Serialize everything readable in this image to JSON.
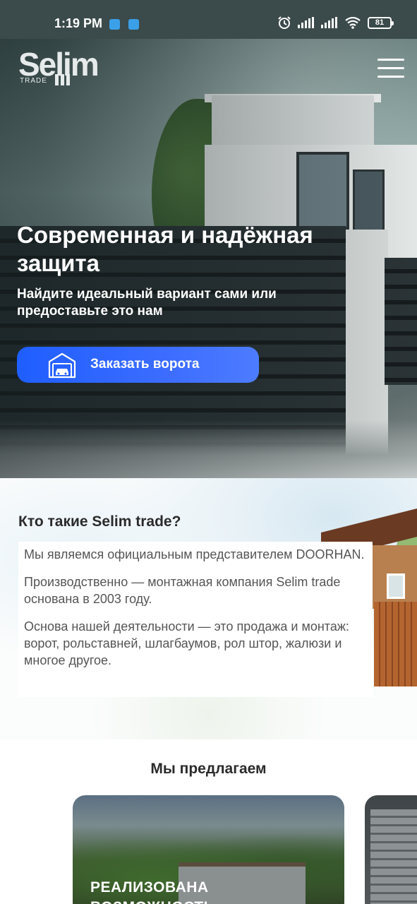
{
  "status_bar": {
    "time": "1:19 PM",
    "battery": "81",
    "icons": [
      "alarm-icon",
      "signal-icon",
      "signal-icon",
      "wifi-icon",
      "battery-icon"
    ]
  },
  "header": {
    "logo_text": "Selim",
    "logo_sub": "TRADE",
    "menu_icon": "hamburger-icon"
  },
  "hero": {
    "title": "Современная и надёжная защита",
    "subtitle": "Найдите идеальный вариант сами или предоставьте это нам",
    "cta_label": "Заказать ворота",
    "cta_icon": "garage-car-icon",
    "cta_color": "#2962ff"
  },
  "about": {
    "title": "Кто такие Selim trade?",
    "paragraphs": [
      "Мы являемся официальным представителем DOORHAN.",
      "Производственно — монтажная компания Selim trade основана в 2003 году.",
      "Основа нашей деятельности — это продажа и монтаж: ворот, рольставней, шлагбаумов, рол штор, жалюзи и многое другое."
    ]
  },
  "offers": {
    "title": "Мы предлагаем",
    "cards": [
      {
        "title": "РЕАЛИЗОВАНА ВОЗМОЖНОСТЬ"
      }
    ]
  }
}
